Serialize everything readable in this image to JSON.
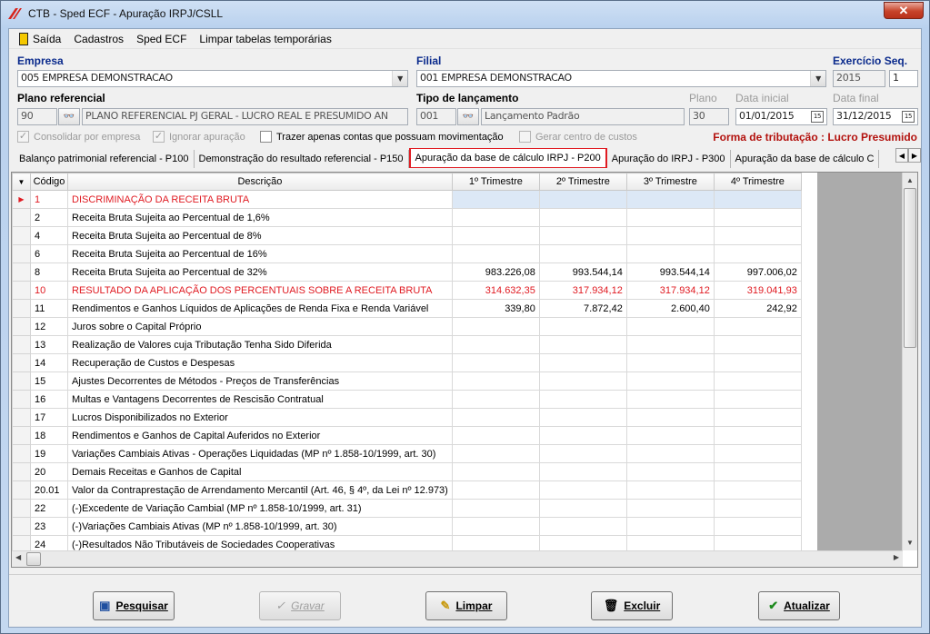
{
  "window": {
    "title": "CTB - Sped ECF - Apuração IRPJ/CSLL",
    "close_glyph": "✕"
  },
  "menu": {
    "items": [
      "Saída",
      "Cadastros",
      "Sped ECF",
      "Limpar tabelas temporárias"
    ]
  },
  "form": {
    "empresa": {
      "label": "Empresa",
      "value": "005 EMPRESA DEMONSTRACAO"
    },
    "filial": {
      "label": "Filial",
      "value": "001 EMPRESA DEMONSTRACAO"
    },
    "exercicio": {
      "label": "Exercício Seq.",
      "year": "2015",
      "seq": "1"
    },
    "plano_referencial": {
      "label": "Plano referencial",
      "code": "90",
      "description": "PLANO REFERENCIAL PJ GERAL - LUCRO REAL E PRESUMIDO AN"
    },
    "tipo_lancamento": {
      "label": "Tipo de lançamento",
      "code": "001",
      "description": "Lançamento Padrão"
    },
    "plano": {
      "label": "Plano",
      "value": "30"
    },
    "data_inicial": {
      "label": "Data inicial",
      "value": "01/01/2015"
    },
    "data_final": {
      "label": "Data final",
      "value": "31/12/2015"
    },
    "checkboxes": [
      {
        "label": "Consolidar por empresa",
        "checked": true,
        "enabled": false
      },
      {
        "label": "Ignorar apuração",
        "checked": true,
        "enabled": false
      },
      {
        "label": "Trazer apenas contas que possuam movimentação",
        "checked": false,
        "enabled": true
      },
      {
        "label": "Gerar centro de custos",
        "checked": false,
        "enabled": false
      }
    ],
    "check_glyph": "✓",
    "tributacao": "Forma de tributação : Lucro Presumido"
  },
  "tabs": [
    {
      "label": "Balanço patrimonial referencial - P100",
      "active": false
    },
    {
      "label": "Demonstração do resultado referencial - P150",
      "active": false
    },
    {
      "label": "Apuração da base de cálculo IRPJ - P200",
      "active": true
    },
    {
      "label": "Apuração do IRPJ - P300",
      "active": false
    },
    {
      "label": "Apuração da base de cálculo C",
      "active": false
    }
  ],
  "grid": {
    "columns": [
      "Código",
      "Descrição",
      "1º Trimestre",
      "2º Trimestre",
      "3º Trimestre",
      "4º Trimestre"
    ],
    "rows": [
      {
        "code": "1",
        "desc": "DISCRIMINAÇÃO DA RECEITA BRUTA",
        "t1": "",
        "t2": "",
        "t3": "",
        "t4": "",
        "red": true,
        "current": true
      },
      {
        "code": "2",
        "desc": "Receita Bruta Sujeita ao Percentual de 1,6%",
        "t1": "",
        "t2": "",
        "t3": "",
        "t4": ""
      },
      {
        "code": "4",
        "desc": "Receita Bruta Sujeita ao Percentual de 8%",
        "t1": "",
        "t2": "",
        "t3": "",
        "t4": ""
      },
      {
        "code": "6",
        "desc": "Receita Bruta Sujeita ao Percentual de 16%",
        "t1": "",
        "t2": "",
        "t3": "",
        "t4": ""
      },
      {
        "code": "8",
        "desc": "Receita Bruta Sujeita ao Percentual de 32%",
        "t1": "983.226,08",
        "t2": "993.544,14",
        "t3": "993.544,14",
        "t4": "997.006,02"
      },
      {
        "code": "10",
        "desc": "RESULTADO DA APLICAÇÃO DOS PERCENTUAIS SOBRE A RECEITA BRUTA",
        "t1": "314.632,35",
        "t2": "317.934,12",
        "t3": "317.934,12",
        "t4": "319.041,93",
        "red": true
      },
      {
        "code": "11",
        "desc": "Rendimentos e Ganhos Líquidos de Aplicações de Renda Fixa e Renda Variável",
        "t1": "339,80",
        "t2": "7.872,42",
        "t3": "2.600,40",
        "t4": "242,92"
      },
      {
        "code": "12",
        "desc": "Juros sobre o Capital Próprio",
        "t1": "",
        "t2": "",
        "t3": "",
        "t4": ""
      },
      {
        "code": "13",
        "desc": "Realização de Valores cuja Tributação Tenha Sido Diferida",
        "t1": "",
        "t2": "",
        "t3": "",
        "t4": ""
      },
      {
        "code": "14",
        "desc": "Recuperação de Custos e Despesas",
        "t1": "",
        "t2": "",
        "t3": "",
        "t4": ""
      },
      {
        "code": "15",
        "desc": "Ajustes Decorrentes de Métodos - Preços de Transferências",
        "t1": "",
        "t2": "",
        "t3": "",
        "t4": ""
      },
      {
        "code": "16",
        "desc": "Multas e Vantagens Decorrentes de Rescisão Contratual",
        "t1": "",
        "t2": "",
        "t3": "",
        "t4": ""
      },
      {
        "code": "17",
        "desc": "Lucros Disponibilizados no Exterior",
        "t1": "",
        "t2": "",
        "t3": "",
        "t4": ""
      },
      {
        "code": "18",
        "desc": "Rendimentos e Ganhos de Capital Auferidos no Exterior",
        "t1": "",
        "t2": "",
        "t3": "",
        "t4": ""
      },
      {
        "code": "19",
        "desc": "Variações Cambiais Ativas - Operações Liquidadas (MP nº 1.858-10/1999, art. 30)",
        "t1": "",
        "t2": "",
        "t3": "",
        "t4": ""
      },
      {
        "code": "20",
        "desc": "Demais Receitas e Ganhos de Capital",
        "t1": "",
        "t2": "",
        "t3": "",
        "t4": ""
      },
      {
        "code": "20.01",
        "desc": "Valor da Contraprestação de Arrendamento Mercantil (Art. 46, § 4º, da Lei nº 12.973)",
        "t1": "",
        "t2": "",
        "t3": "",
        "t4": ""
      },
      {
        "code": "22",
        "desc": "(-)Excedente de Variação Cambial (MP nº 1.858-10/1999, art. 31)",
        "t1": "",
        "t2": "",
        "t3": "",
        "t4": ""
      },
      {
        "code": "23",
        "desc": "(-)Variações Cambiais Ativas (MP nº 1.858-10/1999, art. 30)",
        "t1": "",
        "t2": "",
        "t3": "",
        "t4": ""
      },
      {
        "code": "24",
        "desc": "(-)Resultados Não Tributáveis de Sociedades Cooperativas",
        "t1": "",
        "t2": "",
        "t3": "",
        "t4": ""
      }
    ]
  },
  "buttons": {
    "pesquisar": "Pesquisar",
    "gravar": "Gravar",
    "limpar": "Limpar",
    "excluir": "Excluir",
    "atualizar": "Atualizar"
  },
  "colors": {
    "accent_red": "#e01b22",
    "label_blue": "#0a2a8c",
    "tributacao_red": "#b3120e"
  }
}
